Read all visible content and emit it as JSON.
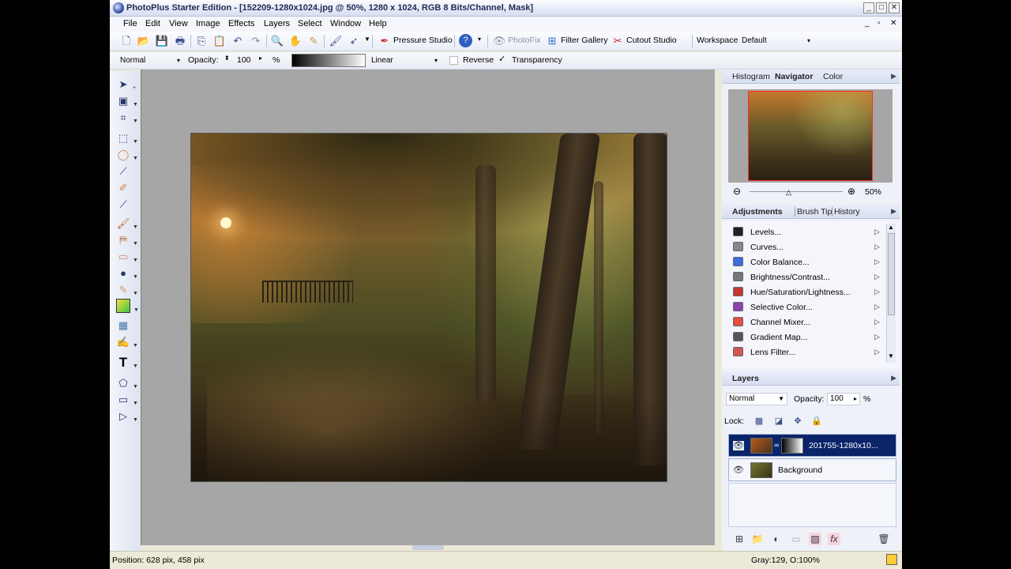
{
  "window": {
    "title": "PhotoPlus Starter Edition - [152209-1280x1024.jpg @ 50%, 1280 x 1024, RGB 8 Bits/Channel, Mask]",
    "controls": [
      "_",
      "□",
      "✕"
    ],
    "doc_controls": [
      "_",
      "▫",
      "✕"
    ]
  },
  "menu": [
    "File",
    "Edit",
    "View",
    "Image",
    "Effects",
    "Layers",
    "Select",
    "Window",
    "Help"
  ],
  "toolbar": {
    "pressure_studio": "Pressure Studio",
    "photofix": "PhotoFix",
    "filter_gallery": "Filter Gallery",
    "cutout_studio": "Cutout Studio",
    "workspace_label": "Workspace",
    "workspace_value": "Default"
  },
  "context_bar": {
    "blend_mode": "Normal",
    "opacity_label": "Opacity:",
    "opacity_value": "100",
    "percent": "%",
    "gradient_type": "Linear",
    "reverse_label": "Reverse",
    "transparency_label": "Transparency",
    "reverse_checked": false,
    "transparency_checked": true
  },
  "navigator": {
    "tabs": [
      "Histogram",
      "Navigator",
      "Color"
    ],
    "zoom": "50%"
  },
  "adjustments": {
    "tabs": [
      "Adjustments",
      "Brush Tip",
      "History"
    ],
    "items": [
      {
        "label": "Levels...",
        "icon": "levels-icon",
        "color": "#222222"
      },
      {
        "label": "Curves...",
        "icon": "curves-icon",
        "color": "#888888"
      },
      {
        "label": "Color Balance...",
        "icon": "color-balance-icon",
        "color": "#3a6fd8"
      },
      {
        "label": "Brightness/Contrast...",
        "icon": "brightness-icon",
        "color": "#777777"
      },
      {
        "label": "Hue/Saturation/Lightness...",
        "icon": "hue-icon",
        "color": "#c0392b"
      },
      {
        "label": "Selective Color...",
        "icon": "selective-color-icon",
        "color": "#8e44ad"
      },
      {
        "label": "Channel Mixer...",
        "icon": "channel-mixer-icon",
        "color": "#e74c3c"
      },
      {
        "label": "Gradient Map...",
        "icon": "gradient-map-icon",
        "color": "#555555"
      },
      {
        "label": "Lens Filter...",
        "icon": "lens-filter-icon",
        "color": "#d35454"
      }
    ]
  },
  "layers": {
    "title": "Layers",
    "blend_mode": "Normal",
    "opacity_label": "Opacity:",
    "opacity_value": "100",
    "percent": "%",
    "lock_label": "Lock:",
    "items": [
      {
        "name": "201755-1280x10...",
        "selected": true
      },
      {
        "name": "Background",
        "selected": false
      }
    ]
  },
  "status": {
    "position": "Position: 628 pix, 458 pix",
    "color": "Gray:129, O:100%"
  }
}
